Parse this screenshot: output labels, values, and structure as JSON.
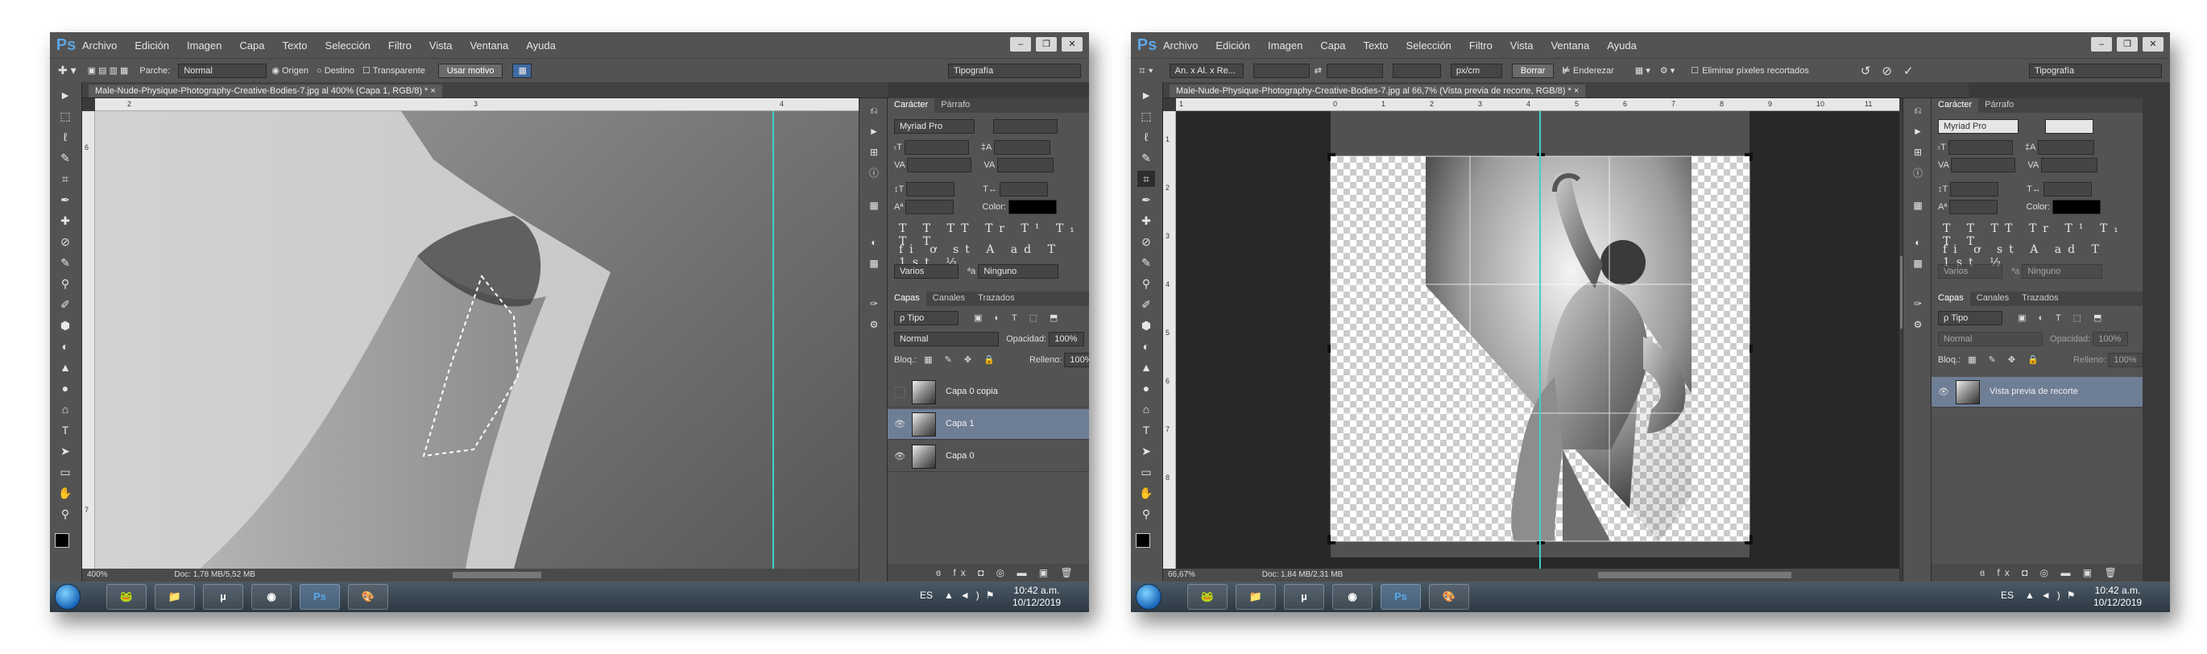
{
  "menu": [
    "Archivo",
    "Edición",
    "Imagen",
    "Capa",
    "Texto",
    "Selección",
    "Filtro",
    "Vista",
    "Ventana",
    "Ayuda"
  ],
  "app_logo": "Ps",
  "window_buttons": [
    "–",
    "❐",
    "✕"
  ],
  "left": {
    "options": {
      "parche_label": "Parche:",
      "parche_value": "Normal",
      "origen_label": "Origen",
      "destino_label": "Destino",
      "transparente_label": "Transparente",
      "usar_motivo": "Usar motivo"
    },
    "workspace": "Tipografía",
    "doc_tab": "Male-Nude-Physique-Photography-Creative-Bodies-7.jpg al 400% (Capa 1, RGB/8) * ×",
    "ruler_top": [
      "2",
      "3",
      "4"
    ],
    "ruler_left": [
      "6",
      "7"
    ],
    "status_zoom": "400%",
    "status_doc": "Doc: 1,78 MB/5,52 MB",
    "character": {
      "tab1": "Carácter",
      "tab2": "Párrafo",
      "font": "Myriad Pro",
      "color_label": "Color:",
      "glyphs1": "T T TT Tr T¹ T₁ T T",
      "glyphs2": "fi ơ st A ad T 1st ½",
      "aa_value": "Varios",
      "aa_lang": "Ninguno"
    },
    "layers": {
      "tab1": "Capas",
      "tab2": "Canales",
      "tab3": "Trazados",
      "filter": "ρ Tipo",
      "blend": "Normal",
      "opacity_label": "Opacidad:",
      "opacity_value": "100%",
      "lock_label": "Bloq.:",
      "fill_label": "Relleno:",
      "fill_value": "100%",
      "items": [
        {
          "name": "Capa 0 copia"
        },
        {
          "name": "Capa 1"
        },
        {
          "name": "Capa 0"
        }
      ],
      "footer": "ɞ fx ◘ ◎ ▬ ▣ 🗑"
    }
  },
  "right": {
    "options": {
      "ratio_value": "An. x Al. x Re...",
      "unit_value": "px/cm",
      "borrar": "Borrar",
      "enderezar": "Enderezar",
      "eliminar": "Eliminar píxeles recortados"
    },
    "workspace": "Tipografía",
    "doc_tab": "Male-Nude-Physique-Photography-Creative-Bodies-7.jpg al 66,7% (Vista previa de recorte, RGB/8) * ×",
    "ruler_top": [
      "1",
      "0",
      "1",
      "2",
      "3",
      "4",
      "5",
      "6",
      "7",
      "8",
      "9",
      "10",
      "11"
    ],
    "ruler_left": [
      "1",
      "2",
      "3",
      "4",
      "5",
      "6",
      "7",
      "8"
    ],
    "status_zoom": "66,67%",
    "status_doc": "Doc: 1,84 MB/2,31 MB",
    "character": {
      "tab1": "Carácter",
      "tab2": "Párrafo",
      "font": "Myriad Pro",
      "color_label": "Color:",
      "glyphs1": "T T TT Tr T¹ T₁ T T",
      "glyphs2": "fi ơ st A ad T 1st ½",
      "aa_value": "Varios",
      "aa_lang": "Ninguno"
    },
    "layers": {
      "tab1": "Capas",
      "tab2": "Canales",
      "tab3": "Trazados",
      "filter": "ρ Tipo",
      "blend": "Normal",
      "opacity_label": "Opacidad:",
      "opacity_value": "100%",
      "lock_label": "Bloq.:",
      "fill_label": "Relleno:",
      "fill_value": "100%",
      "items": [
        {
          "name": "Vista previa de recorte"
        }
      ],
      "footer": "ɞ fx ◘ ◎ ▬ ▣ 🗑"
    }
  },
  "taskbar": {
    "apps": [
      "🐸",
      "📁",
      "µ",
      "◉",
      "Ps",
      "🎨"
    ],
    "lang": "ES",
    "time": "10:42 a.m.",
    "date": "10/12/2019"
  },
  "tools": [
    "►",
    "⬚",
    "ℓ",
    "✎",
    "⌗",
    "✒",
    "✚",
    "⊘",
    "✎",
    "⚲",
    "✐",
    "⬢",
    "◐",
    "▲",
    "●",
    "⌂",
    "T",
    "➤",
    "▭",
    "✋",
    "⚲"
  ],
  "colors": {
    "accent": "#6e7e95",
    "guide": "#3fcfcf",
    "selection": "#ffffff"
  }
}
